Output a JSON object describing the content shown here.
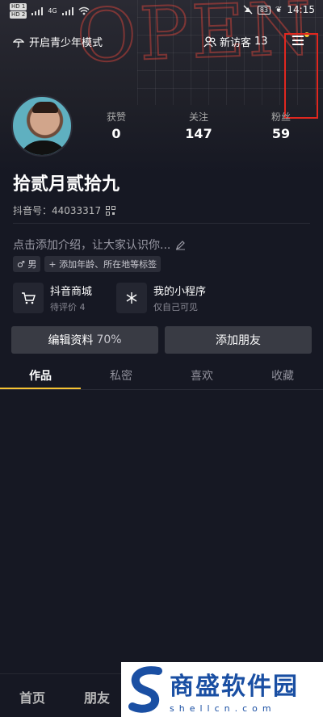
{
  "status_bar": {
    "sim1": "HD 1",
    "sim2": "HD 2",
    "net": "4G",
    "battery": "83",
    "time": "14:15"
  },
  "topnav": {
    "teen_mode": "开启青少年模式",
    "visitors_label": "新访客",
    "visitors_count": "13",
    "menu_icon": "hamburger-menu-icon",
    "notify_dot_color": "#f7c433"
  },
  "profile": {
    "stats": [
      {
        "label": "获赞",
        "value": "0"
      },
      {
        "label": "关注",
        "value": "147"
      },
      {
        "label": "粉丝",
        "value": "59"
      }
    ],
    "username": "拾贰月贰拾九",
    "douyin_id": "抖音号：44033317",
    "intro": "点击添加介绍，让大家认识你...",
    "tags": [
      "♂ 男",
      "+ 添加年龄、所在地等标签"
    ]
  },
  "services": [
    {
      "title": "抖音商城",
      "subtitle": "待评价 4",
      "icon": "shopping-cart-icon"
    },
    {
      "title": "我的小程序",
      "subtitle": "仅自己可见",
      "icon": "mini-program-icon"
    }
  ],
  "buttons": {
    "edit": "编辑资料",
    "edit_pct": "70%",
    "add_friend": "添加朋友"
  },
  "tabs": [
    "作品",
    "私密",
    "喜欢",
    "收藏"
  ],
  "bottom_nav": [
    "首页",
    "朋友"
  ],
  "watermark": {
    "cn": "商盛软件园",
    "en": "shellcn.com"
  },
  "colors": {
    "accent": "#f7c433",
    "highlight_box": "#e0271f",
    "background": "#161823"
  }
}
